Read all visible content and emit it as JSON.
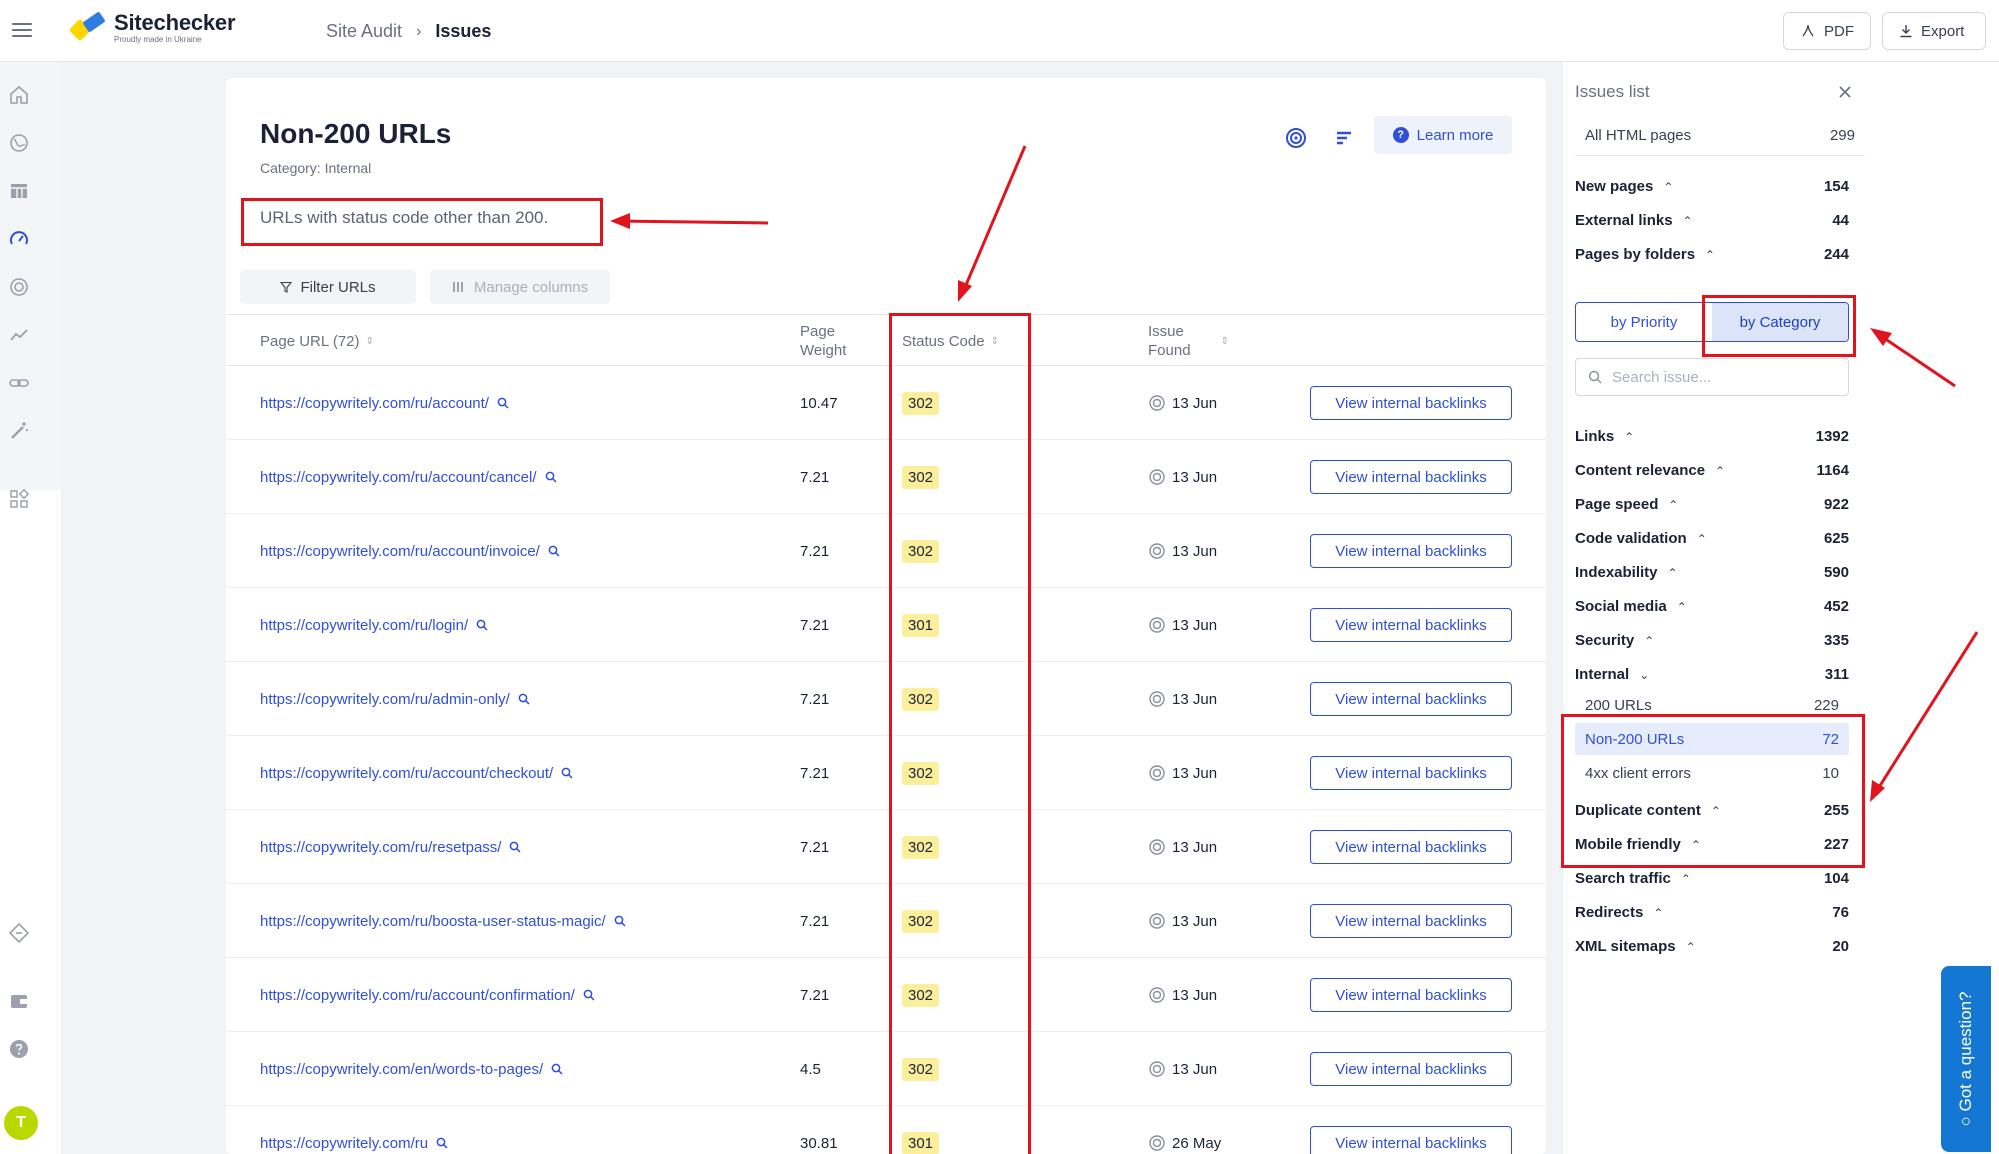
{
  "header": {
    "brand": "Sitechecker",
    "brand_sub": "Proudly made in Ukraine",
    "breadcrumb_parent": "Site Audit",
    "breadcrumb_sep": "›",
    "breadcrumb_current": "Issues",
    "pdf_label": "PDF",
    "export_label": "Export"
  },
  "sidebar_icons": [
    "home-icon",
    "globe-icon",
    "table-icon",
    "speedometer-icon",
    "target-icon",
    "trend-icon",
    "link-icon",
    "magic-wand-icon",
    "widgets-icon",
    "diamond-icon",
    "wallet-icon",
    "help-icon"
  ],
  "user": {
    "avatar_letter": "T",
    "avatar_color": "#b8d800"
  },
  "issue": {
    "title": "Non-200 URLs",
    "category": "Category: Internal",
    "description": "URLs with status code other than 200.",
    "learn_more": "Learn more",
    "filter_label": "Filter URLs",
    "manage_label": "Manage columns"
  },
  "table": {
    "col_url": "Page URL (72)",
    "col_weight_1": "Page",
    "col_weight_2": "Weight",
    "col_status": "Status Code",
    "col_issue_1": "Issue",
    "col_issue_2": "Found",
    "button_label": "View internal backlinks",
    "rows": [
      {
        "url": "https://copywritely.com/ru/account/",
        "weight": "10.47",
        "status": "302",
        "found": "13 Jun"
      },
      {
        "url": "https://copywritely.com/ru/account/cancel/",
        "weight": "7.21",
        "status": "302",
        "found": "13 Jun"
      },
      {
        "url": "https://copywritely.com/ru/account/invoice/",
        "weight": "7.21",
        "status": "302",
        "found": "13 Jun"
      },
      {
        "url": "https://copywritely.com/ru/login/",
        "weight": "7.21",
        "status": "301",
        "found": "13 Jun"
      },
      {
        "url": "https://copywritely.com/ru/admin-only/",
        "weight": "7.21",
        "status": "302",
        "found": "13 Jun"
      },
      {
        "url": "https://copywritely.com/ru/account/checkout/",
        "weight": "7.21",
        "status": "302",
        "found": "13 Jun"
      },
      {
        "url": "https://copywritely.com/ru/resetpass/",
        "weight": "7.21",
        "status": "302",
        "found": "13 Jun"
      },
      {
        "url": "https://copywritely.com/ru/boosta-user-status-magic/",
        "weight": "7.21",
        "status": "302",
        "found": "13 Jun"
      },
      {
        "url": "https://copywritely.com/ru/account/confirmation/",
        "weight": "7.21",
        "status": "302",
        "found": "13 Jun"
      },
      {
        "url": "https://copywritely.com/en/words-to-pages/",
        "weight": "4.5",
        "status": "302",
        "found": "13 Jun"
      },
      {
        "url": "https://copywritely.com/ru",
        "weight": "30.81",
        "status": "301",
        "found": "26 May"
      }
    ]
  },
  "issues_panel": {
    "title": "Issues list",
    "all_label": "All HTML pages",
    "all_count": "299",
    "top_groups": [
      {
        "label": "New pages",
        "count": "154"
      },
      {
        "label": "External links",
        "count": "44"
      },
      {
        "label": "Pages by folders",
        "count": "244"
      }
    ],
    "by_priority": "by Priority",
    "by_category": "by Category",
    "search_placeholder": "Search issue...",
    "categories_top": [
      {
        "label": "Links",
        "count": "1392"
      },
      {
        "label": "Content relevance",
        "count": "1164"
      },
      {
        "label": "Page speed",
        "count": "922"
      },
      {
        "label": "Code validation",
        "count": "625"
      },
      {
        "label": "Indexability",
        "count": "590"
      },
      {
        "label": "Social media",
        "count": "452"
      },
      {
        "label": "Security",
        "count": "335"
      }
    ],
    "internal_label": "Internal",
    "internal_count": "311",
    "internal_items": [
      {
        "label": "200 URLs",
        "count": "229"
      },
      {
        "label": "Non-200 URLs",
        "count": "72"
      },
      {
        "label": "4xx client errors",
        "count": "10"
      }
    ],
    "categories_bottom": [
      {
        "label": "Duplicate content",
        "count": "255"
      },
      {
        "label": "Mobile friendly",
        "count": "227"
      },
      {
        "label": "Search traffic",
        "count": "104"
      },
      {
        "label": "Redirects",
        "count": "76"
      },
      {
        "label": "XML sitemaps",
        "count": "20"
      }
    ]
  },
  "chat_label": "Got a question?",
  "colors": {
    "accent": "#2f4fd8",
    "annotation_red": "#e0141d",
    "status_badge": "#fbef9c",
    "chat_blue": "#1577d4"
  }
}
